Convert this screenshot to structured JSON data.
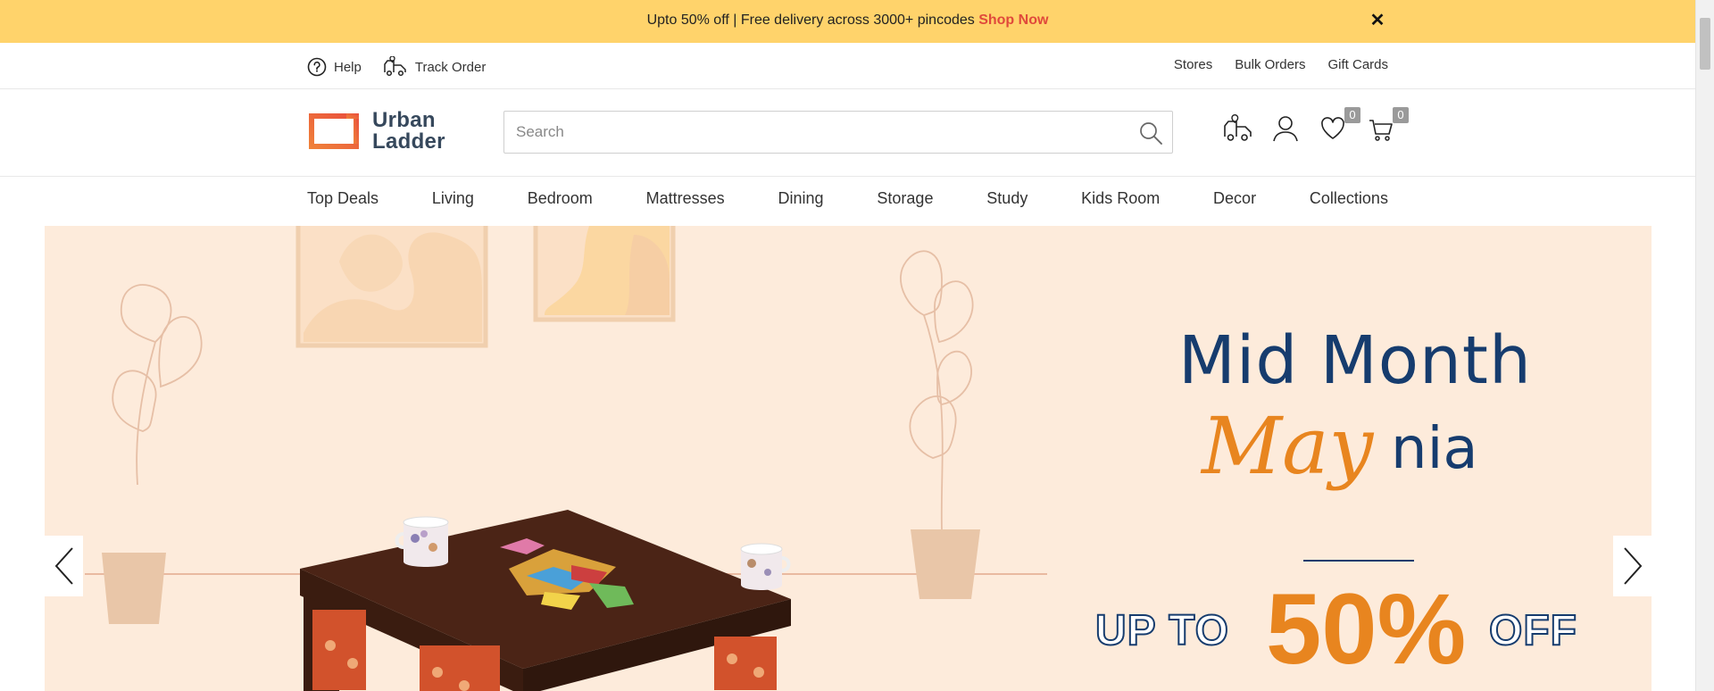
{
  "promo": {
    "text": "Upto 50% off | Free delivery across 3000+ pincodes ",
    "link": "Shop Now",
    "close": "✕"
  },
  "utility": {
    "help": "Help",
    "track_order": "Track Order",
    "stores": "Stores",
    "bulk_orders": "Bulk Orders",
    "gift_cards": "Gift Cards"
  },
  "header": {
    "logo_line1": "Urban",
    "logo_line2": "Ladder",
    "search_placeholder": "Search",
    "wishlist_count": "0",
    "cart_count": "0"
  },
  "categories": [
    "Top Deals",
    "Living",
    "Bedroom",
    "Mattresses",
    "Dining",
    "Storage",
    "Study",
    "Kids Room",
    "Decor",
    "Collections"
  ],
  "hero": {
    "line1": "Mid Month",
    "script": "May",
    "line2": "nia",
    "upto": "UP TO",
    "percent": "50%",
    "off": "OFF"
  },
  "colors": {
    "promo_bg": "#ffd36b",
    "shop_now": "#e0493b",
    "brand_navy": "#163c6e",
    "brand_orange": "#e8851f",
    "hero_bg": "#fdebdb"
  }
}
